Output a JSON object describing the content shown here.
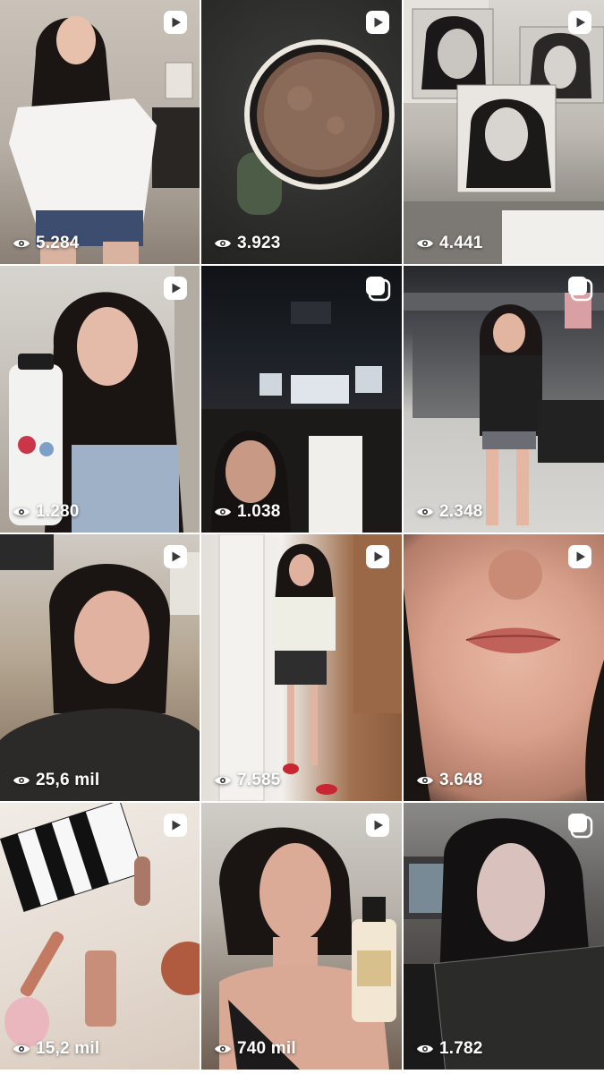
{
  "grid": {
    "tiles": [
      {
        "views": "5.284",
        "media_type": "reel"
      },
      {
        "views": "3.923",
        "media_type": "reel"
      },
      {
        "views": "4.441",
        "media_type": "reel"
      },
      {
        "views": "1.280",
        "media_type": "reel"
      },
      {
        "views": "1.038",
        "media_type": "carousel"
      },
      {
        "views": "2.348",
        "media_type": "carousel"
      },
      {
        "views": "25,6 mil",
        "media_type": "reel"
      },
      {
        "views": "7.585",
        "media_type": "reel"
      },
      {
        "views": "3.648",
        "media_type": "reel"
      },
      {
        "views": "15,2 mil",
        "media_type": "reel"
      },
      {
        "views": "740 mil",
        "media_type": "reel"
      },
      {
        "views": "1.782",
        "media_type": "carousel"
      }
    ]
  },
  "icons": {
    "views": "eye-icon",
    "reel": "reel-play-icon",
    "carousel": "carousel-icon"
  },
  "colors": {
    "overlay_text": "#ffffff",
    "background": "#ffffff"
  }
}
